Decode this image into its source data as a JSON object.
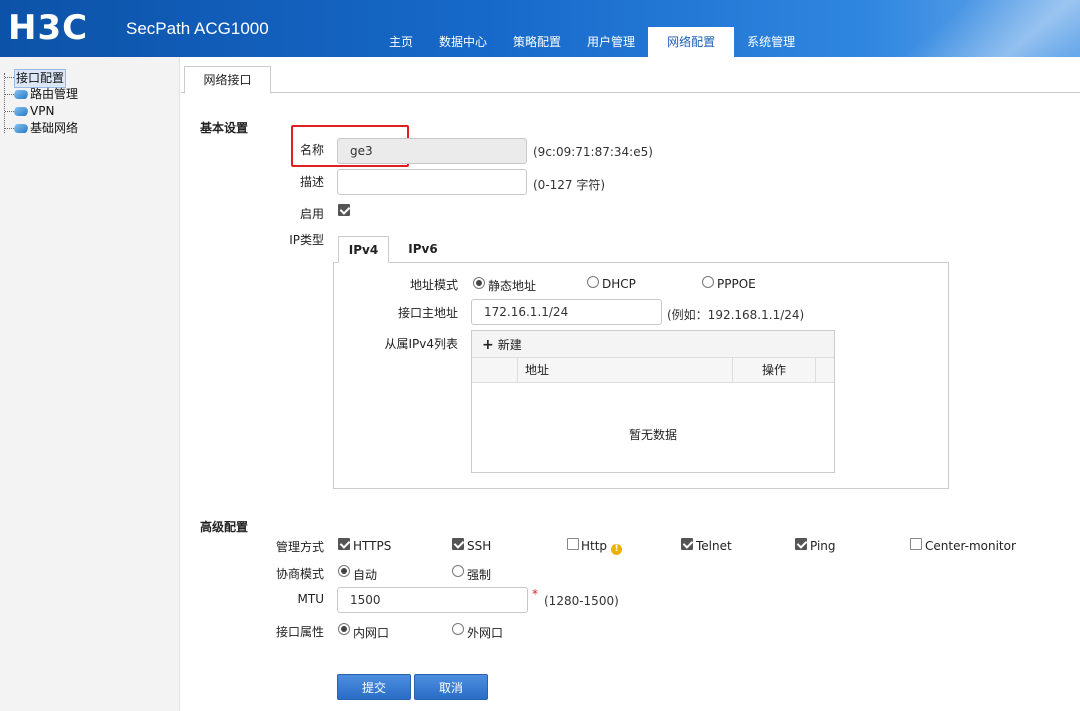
{
  "header": {
    "logo": "H3C",
    "product": "SecPath ACG1000",
    "nav": [
      "主页",
      "数据中心",
      "策略配置",
      "用户管理",
      "网络配置",
      "系统管理"
    ],
    "active_nav": "网络配置"
  },
  "sidebar": {
    "items": [
      {
        "label": "接口配置",
        "selected": true,
        "icon": "none"
      },
      {
        "label": "路由管理",
        "icon": "leaf-icon"
      },
      {
        "label": "VPN",
        "icon": "leaf-icon"
      },
      {
        "label": "基础网络",
        "icon": "leaf-icon"
      }
    ]
  },
  "page_tab": "网络接口",
  "basic": {
    "title": "基本设置",
    "name_label": "名称",
    "name_value": "ge3",
    "mac": "(9c:09:71:87:34:e5)",
    "desc_label": "描述",
    "desc_value": "",
    "desc_hint": "(0-127 字符)",
    "enable_label": "启用",
    "enable_checked": true,
    "iptype_label": "IP类型"
  },
  "ip_tabs": [
    "IPv4",
    "IPv6"
  ],
  "ipv4": {
    "mode_label": "地址模式",
    "modes": [
      "静态地址",
      "DHCP",
      "PPPOE"
    ],
    "selected_mode": "静态地址",
    "addr_label": "接口主地址",
    "addr_value": "172.16.1.1/24",
    "addr_hint": "(例如：192.168.1.1/24)",
    "secondary_label": "从属IPv4列表",
    "new_button": "新建",
    "table_headers": [
      "地址",
      "操作"
    ],
    "empty_text": "暂无数据"
  },
  "advanced": {
    "title": "高级配置",
    "mgmt_label": "管理方式",
    "mgmt_options": [
      {
        "label": "HTTPS",
        "checked": true
      },
      {
        "label": "SSH",
        "checked": true
      },
      {
        "label": "Http",
        "checked": false,
        "warning": true
      },
      {
        "label": "Telnet",
        "checked": true
      },
      {
        "label": "Ping",
        "checked": true
      },
      {
        "label": "Center-monitor",
        "checked": false
      }
    ],
    "nego_label": "协商模式",
    "nego_options": [
      "自动",
      "强制"
    ],
    "nego_selected": "自动",
    "mtu_label": "MTU",
    "mtu_value": "1500",
    "mtu_required": "*",
    "mtu_hint": "(1280-1500)",
    "attr_label": "接口属性",
    "attr_options": [
      "内网口",
      "外网口"
    ],
    "attr_selected": "内网口"
  },
  "buttons": {
    "submit": "提交",
    "cancel": "取消"
  },
  "colors": {
    "header_blue": "#1769c9",
    "highlight_red": "#e02020",
    "button_blue": "#2a6dc6"
  }
}
